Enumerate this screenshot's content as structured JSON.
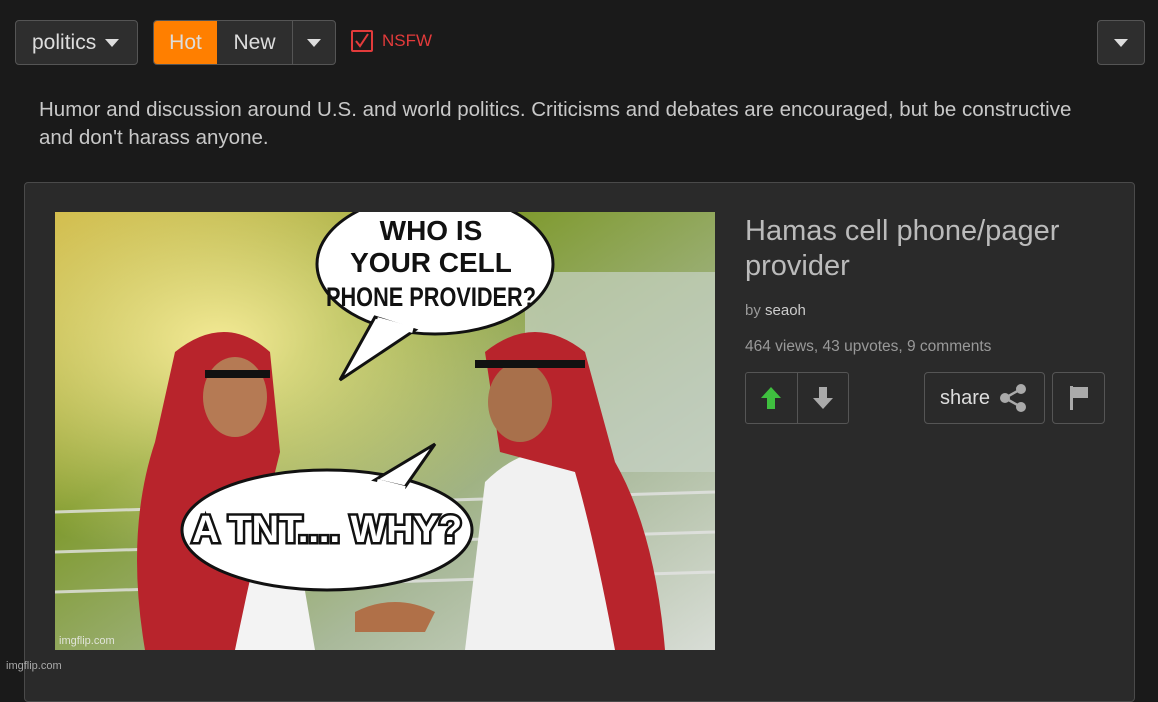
{
  "toolbar": {
    "stream": "politics",
    "sort_hot": "Hot",
    "sort_new": "New",
    "nsfw_label": "NSFW"
  },
  "stream_description": "Humor and discussion around U.S. and world politics. Criticisms and debates are encouraged, but be constructive and don't harass anyone.",
  "post": {
    "title": "Hamas cell phone/pager provider",
    "by_label": "by",
    "author": "seaoh",
    "stats": "464 views, 43 upvotes, 9 comments",
    "share_label": "share",
    "meme": {
      "top_caption_lines": [
        "WHO IS",
        "YOUR CELL",
        "PHONE PROVIDER?"
      ],
      "bottom_caption": "A TNT.... WHY?",
      "image_watermark": "imgflip.com"
    }
  },
  "page_watermark": "imgflip.com",
  "colors": {
    "accent": "#ff7f00",
    "nsfw": "#e23b3b",
    "upvote": "#3fbf3f",
    "background": "#1a1a1a"
  }
}
